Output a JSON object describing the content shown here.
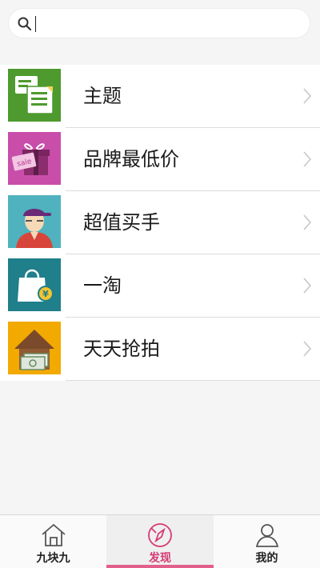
{
  "search": {
    "value": "",
    "placeholder": ""
  },
  "menu": {
    "items": [
      {
        "label": "主题",
        "icon": "theme-icon",
        "tile_color": "#4e9a2e"
      },
      {
        "label": "品牌最低价",
        "icon": "gift-sale-icon",
        "tile_color": "#c84eaa"
      },
      {
        "label": "超值买手",
        "icon": "buyer-avatar-icon",
        "tile_color": "#4fb2be"
      },
      {
        "label": "一淘",
        "icon": "shopping-bag-icon",
        "tile_color": "#1f7f8a"
      },
      {
        "label": "天天抢拍",
        "icon": "house-money-icon",
        "tile_color": "#f2a900"
      }
    ]
  },
  "tabbar": {
    "tabs": [
      {
        "label": "九块九",
        "icon": "home-icon",
        "active": false
      },
      {
        "label": "发现",
        "icon": "compass-icon",
        "active": true
      },
      {
        "label": "我的",
        "icon": "profile-icon",
        "active": false
      }
    ],
    "accent": "#e25f8c"
  }
}
